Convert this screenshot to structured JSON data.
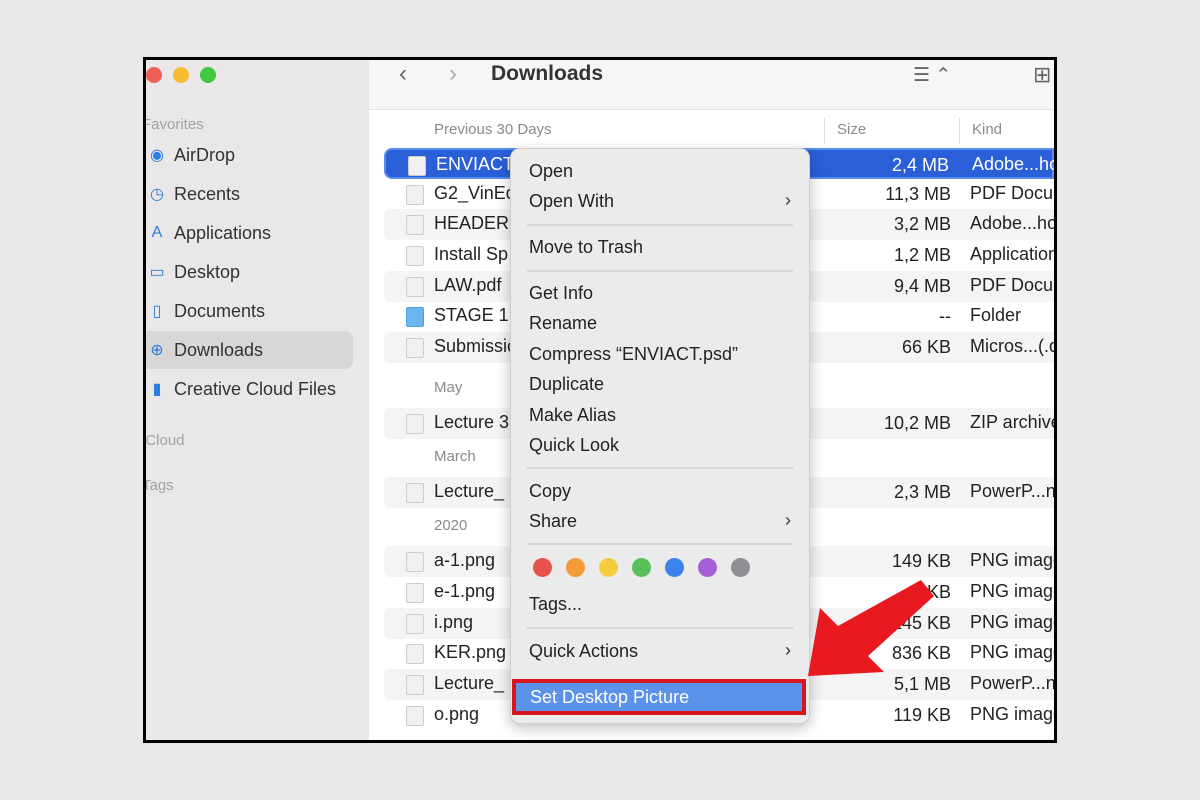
{
  "window": {
    "title": "Downloads",
    "traffic_colors": [
      "#ee5f57",
      "#f5bd2f",
      "#3fc840"
    ]
  },
  "sidebar": {
    "favorites": "Favorites",
    "icloud": "iCloud",
    "tags": "Tags",
    "items": [
      {
        "label": "AirDrop",
        "icon": "airdrop-icon",
        "glyph": "◉"
      },
      {
        "label": "Recents",
        "icon": "clock-icon",
        "glyph": "◷"
      },
      {
        "label": "Applications",
        "icon": "applications-icon",
        "glyph": "A"
      },
      {
        "label": "Desktop",
        "icon": "desktop-icon",
        "glyph": "▭"
      },
      {
        "label": "Documents",
        "icon": "document-icon",
        "glyph": "▯"
      },
      {
        "label": "Downloads",
        "icon": "download-icon",
        "glyph": "⊕",
        "active": true
      },
      {
        "label": "Creative Cloud Files",
        "icon": "file-icon",
        "glyph": "▮"
      }
    ]
  },
  "toolbar": {
    "back": "‹",
    "forward": "›",
    "view": "☰ ⌃",
    "grid": "⊞"
  },
  "columns": {
    "name": "Previous 30 Days",
    "size": "Size",
    "kind": "Kind"
  },
  "rows": [
    {
      "name": "ENVIACT.psd",
      "size": "2,4 MB",
      "kind": "Adobe...hop",
      "selected": true
    },
    {
      "name": "G2_VinEd",
      "size": "11,3 MB",
      "kind": "PDF Document"
    },
    {
      "name": "HEADER1",
      "size": "3,2 MB",
      "kind": "Adobe...hop"
    },
    {
      "name": "Install Sp",
      "size": "1,2 MB",
      "kind": "Application"
    },
    {
      "name": "LAW.pdf",
      "size": "9,4 MB",
      "kind": "PDF Document"
    },
    {
      "name": "STAGE 1",
      "size": "--",
      "kind": "Folder",
      "folder": true
    },
    {
      "name": "Submission",
      "size": "66 KB",
      "kind": "Micros...(.docx)"
    },
    {
      "group": "May"
    },
    {
      "name": "Lecture 3",
      "size": "10,2 MB",
      "kind": "ZIP archive"
    },
    {
      "group": "March"
    },
    {
      "name": "Lecture_",
      "size": "2,3 MB",
      "kind": "PowerP...ntation"
    },
    {
      "group": "2020"
    },
    {
      "name": "a-1.png",
      "size": "149 KB",
      "kind": "PNG image"
    },
    {
      "name": "e-1.png",
      "size": "KB",
      "kind": "PNG image"
    },
    {
      "name": "i.png",
      "size": "145 KB",
      "kind": "PNG image"
    },
    {
      "name": "KER.png",
      "size": "836 KB",
      "kind": "PNG image"
    },
    {
      "name": "Lecture_",
      "size": "5,1 MB",
      "kind": "PowerP...ntation"
    },
    {
      "name": "o.png",
      "size": "119 KB",
      "kind": "PNG image"
    }
  ],
  "menu": {
    "open": "Open",
    "open_with": "Open With",
    "move_to_trash": "Move to Trash",
    "get_info": "Get Info",
    "rename": "Rename",
    "compress": "Compress “ENVIACT.psd”",
    "duplicate": "Duplicate",
    "make_alias": "Make Alias",
    "quick_look": "Quick Look",
    "copy": "Copy",
    "share": "Share",
    "tags": "Tags...",
    "quick_actions": "Quick Actions",
    "set_desktop_picture": "Set Desktop Picture",
    "chevron": "›",
    "tag_colors": [
      "#e5534b",
      "#f29b38",
      "#f5cd3c",
      "#5ac15a",
      "#3b82ea",
      "#a65fd6",
      "#8e8e93"
    ]
  },
  "annotation": {
    "arrow_color": "#e8191f",
    "highlight_color": "#d8141d"
  }
}
